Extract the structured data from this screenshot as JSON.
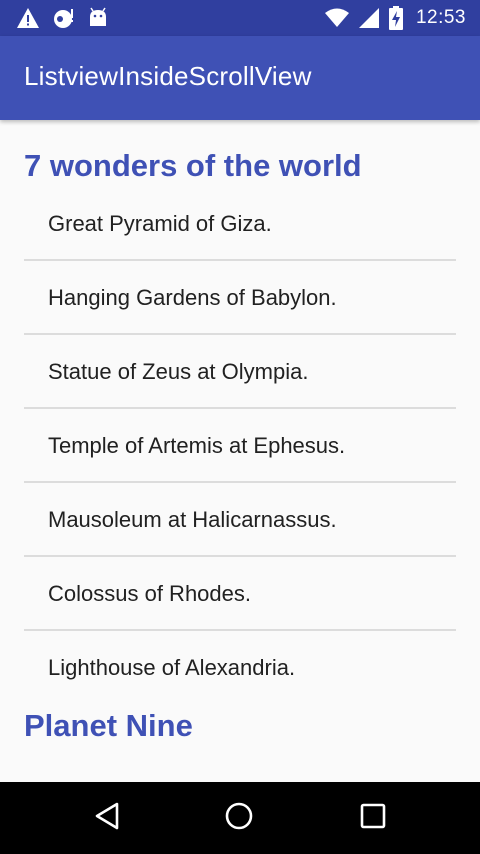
{
  "status_bar": {
    "time": "12:53",
    "icons": [
      "warning-icon",
      "notification-icon",
      "android-icon",
      "wifi-icon",
      "signal-icon",
      "battery-charging-icon"
    ]
  },
  "app_bar": {
    "title": "ListviewInsideScrollView"
  },
  "main": {
    "wonders": {
      "title": "7 wonders of the world",
      "items": [
        "Great Pyramid of Giza.",
        "Hanging Gardens of Babylon.",
        "Statue of Zeus at Olympia.",
        "Temple of Artemis at Ephesus.",
        "Mausoleum at Halicarnassus.",
        "Colossus of Rhodes.",
        "Lighthouse of Alexandria."
      ]
    },
    "planet_nine": {
      "title": "Planet Nine"
    }
  },
  "nav_bar": {
    "buttons": [
      "back-icon",
      "home-icon",
      "recents-icon"
    ]
  },
  "colors": {
    "primary": "#3f51b5",
    "primary_dark": "#303f9f",
    "background": "#fafafa",
    "divider": "#dcdcdc",
    "text": "#212121"
  }
}
